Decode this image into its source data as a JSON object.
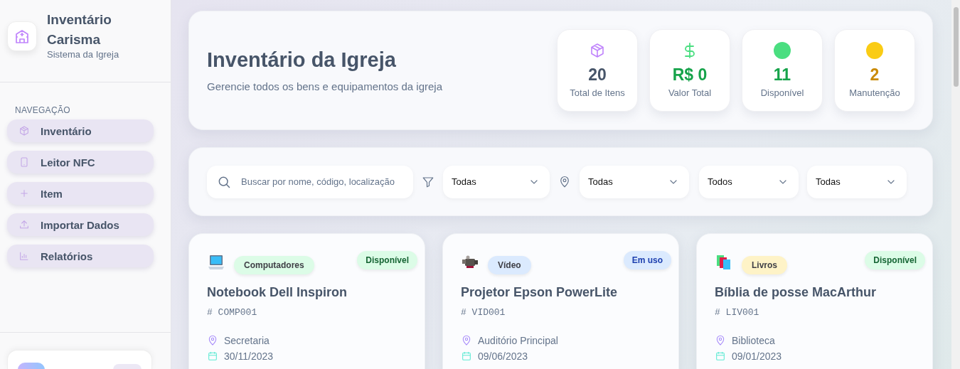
{
  "sidebar": {
    "app_title": "Inventário Carisma",
    "app_subtitle": "Sistema da Igreja",
    "section_label": "NAVEGAÇÃO",
    "items": [
      {
        "label": "Inventário",
        "kind": "box"
      },
      {
        "label": "Leitor NFC",
        "kind": "phone"
      },
      {
        "label": "Item",
        "kind": "plus"
      },
      {
        "label": "Importar Dados",
        "kind": "upload"
      },
      {
        "label": "Relatórios",
        "kind": "chart"
      }
    ]
  },
  "header": {
    "title": "Inventário da Igreja",
    "subtitle": "Gerencie todos os bens e equipamentos da igreja",
    "stats": [
      {
        "kind": "total",
        "value": "20",
        "label": "Total de Itens"
      },
      {
        "kind": "money",
        "value": "R$ 0",
        "label": "Valor Total"
      },
      {
        "kind": "available",
        "value": "11",
        "label": "Disponível"
      },
      {
        "kind": "maintenance",
        "value": "2",
        "label": "Manutenção"
      }
    ]
  },
  "filters": {
    "search": {
      "placeholder": "Buscar por nome, código, localização"
    },
    "selects": [
      {
        "kind": "filter",
        "value": "Todas"
      },
      {
        "kind": "pin",
        "value": "Todas"
      },
      {
        "kind": "none",
        "value": "Todos"
      },
      {
        "kind": "none",
        "value": "Todas"
      }
    ]
  },
  "items": [
    {
      "kind": "laptop",
      "category": {
        "label": "Computadores",
        "color": "#dcfce7"
      },
      "status": {
        "label": "Disponível",
        "kind": "available"
      },
      "name": "Notebook Dell Inspiron",
      "code": "# COMP001",
      "location": "Secretaria",
      "date": "30/11/2023"
    },
    {
      "kind": "camera",
      "category": {
        "label": "Vídeo",
        "color": "#dbeafe"
      },
      "status": {
        "label": "Em uso",
        "kind": "in-use"
      },
      "name": "Projetor Epson PowerLite",
      "code": "# VID001",
      "location": "Auditório Principal",
      "date": "09/06/2023"
    },
    {
      "kind": "books",
      "category": {
        "label": "Livros",
        "color": "#fef3c7"
      },
      "status": {
        "label": "Disponível",
        "kind": "available"
      },
      "name": "Bíblia de posse MacArthur",
      "code": "# LIV001",
      "location": "Biblioteca",
      "date": "09/01/2023"
    }
  ]
}
